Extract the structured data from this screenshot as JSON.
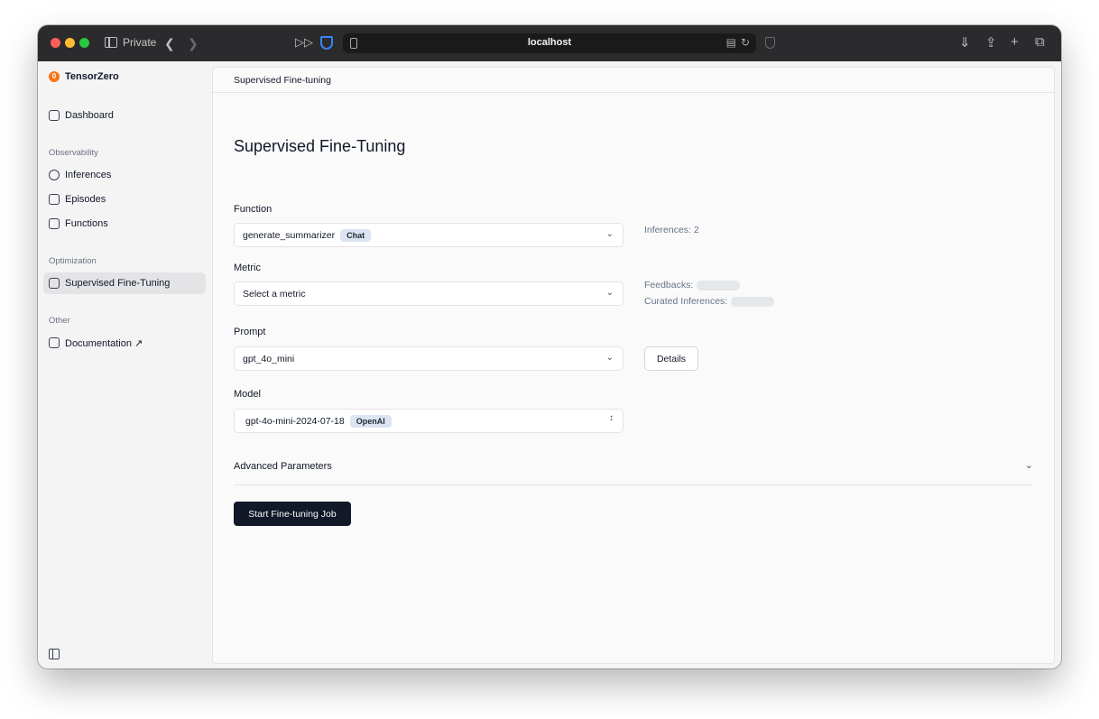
{
  "browser": {
    "mode_label": "Private",
    "url": "localhost"
  },
  "sidebar": {
    "brand": "TensorZero",
    "brand_logo_char": "0",
    "dashboard": "Dashboard",
    "sections": [
      {
        "label": "Observability",
        "items": [
          "Inferences",
          "Episodes",
          "Functions"
        ]
      },
      {
        "label": "Optimization",
        "items": [
          "Supervised Fine-Tuning"
        ]
      },
      {
        "label": "Other",
        "items": [
          "Documentation ↗"
        ]
      }
    ],
    "active_item": "Supervised Fine-Tuning"
  },
  "main": {
    "breadcrumb": "Supervised Fine-tuning",
    "title": "Supervised Fine-Tuning",
    "function": {
      "label": "Function",
      "value": "generate_summarizer",
      "badge": "Chat",
      "inferences_text": "Inferences: 2"
    },
    "metric": {
      "label": "Metric",
      "placeholder": "Select a metric",
      "feedbacks_label": "Feedbacks:",
      "curated_label": "Curated Inferences:"
    },
    "prompt": {
      "label": "Prompt",
      "value": "gpt_4o_mini",
      "details_button": "Details"
    },
    "model": {
      "label": "Model",
      "value": "gpt-4o-mini-2024-07-18",
      "badge": "OpenAI"
    },
    "advanced_label": "Advanced Parameters",
    "start_button": "Start Fine-tuning Job"
  }
}
